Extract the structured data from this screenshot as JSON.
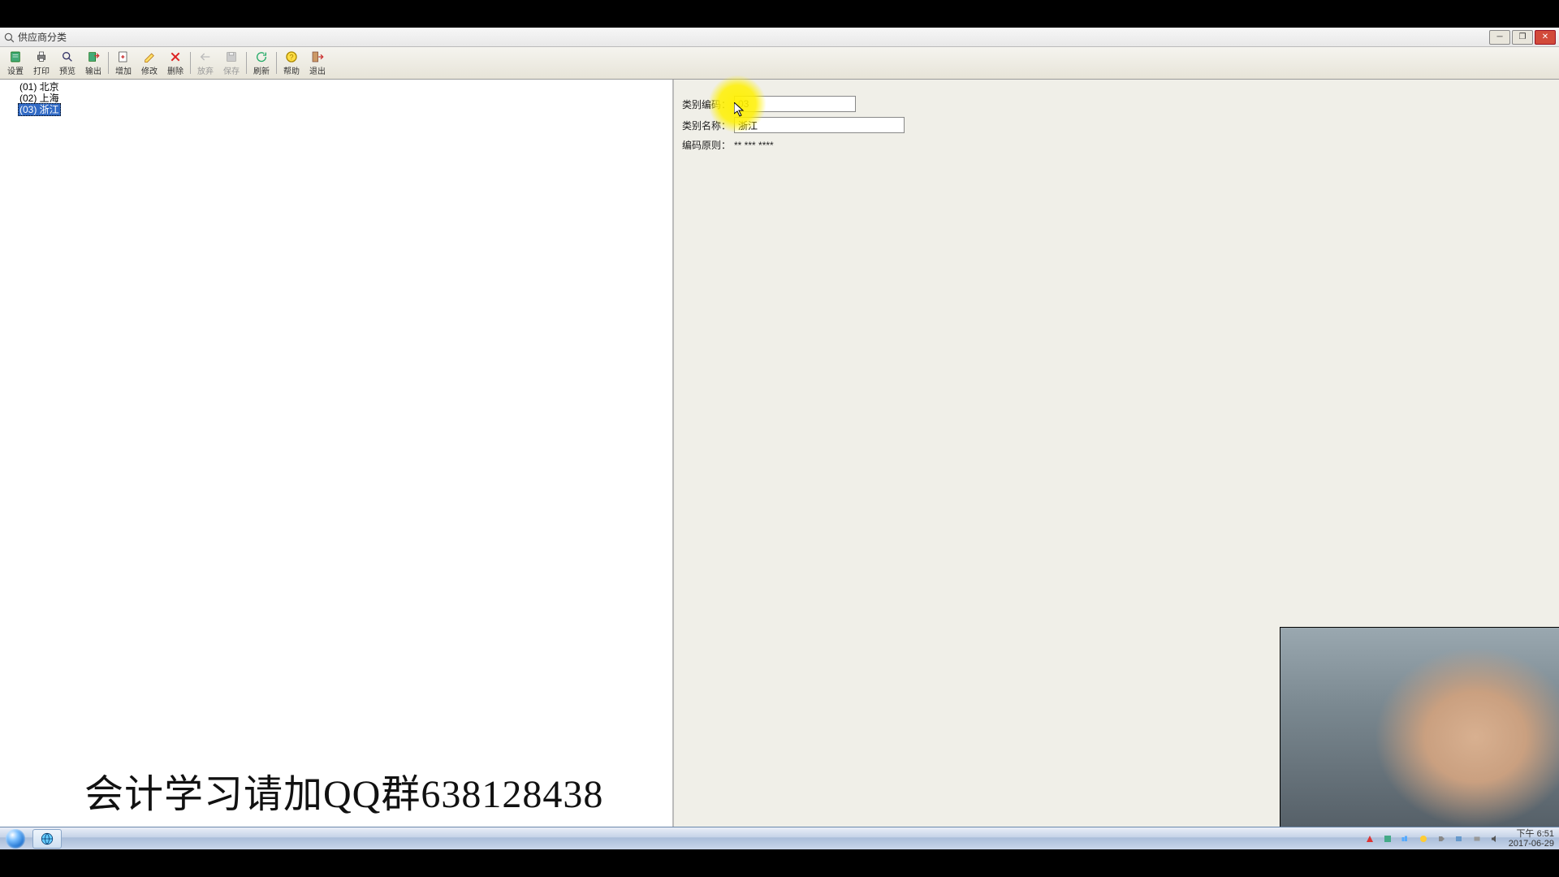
{
  "window": {
    "title": "供应商分类"
  },
  "toolbar": {
    "buttons": [
      {
        "id": "settings",
        "label": "设置",
        "disabled": false
      },
      {
        "id": "print",
        "label": "打印",
        "disabled": false
      },
      {
        "id": "preview",
        "label": "预览",
        "disabled": false
      },
      {
        "id": "output",
        "label": "输出",
        "disabled": false
      },
      {
        "id": "add",
        "label": "增加",
        "disabled": false
      },
      {
        "id": "modify",
        "label": "修改",
        "disabled": false
      },
      {
        "id": "delete",
        "label": "删除",
        "disabled": false
      },
      {
        "id": "abandon",
        "label": "放弃",
        "disabled": true
      },
      {
        "id": "save",
        "label": "保存",
        "disabled": true
      },
      {
        "id": "refresh",
        "label": "刷新",
        "disabled": false
      },
      {
        "id": "help",
        "label": "帮助",
        "disabled": false
      },
      {
        "id": "exit",
        "label": "退出",
        "disabled": false
      }
    ]
  },
  "tree": {
    "items": [
      {
        "id": "01",
        "label": "(01) 北京",
        "selected": false
      },
      {
        "id": "02",
        "label": "(02) 上海",
        "selected": false
      },
      {
        "id": "03",
        "label": "(03) 浙江",
        "selected": true
      }
    ]
  },
  "form": {
    "code_label": "类别编码：",
    "code_value": "03",
    "name_label": "类别名称：",
    "name_value": "浙江",
    "rule_label": "编码原则：",
    "rule_value": "** *** ****"
  },
  "caption": "会计学习请加QQ群638128438",
  "taskbar": {
    "time": "下午 6:51",
    "date": "2017-06-29"
  }
}
